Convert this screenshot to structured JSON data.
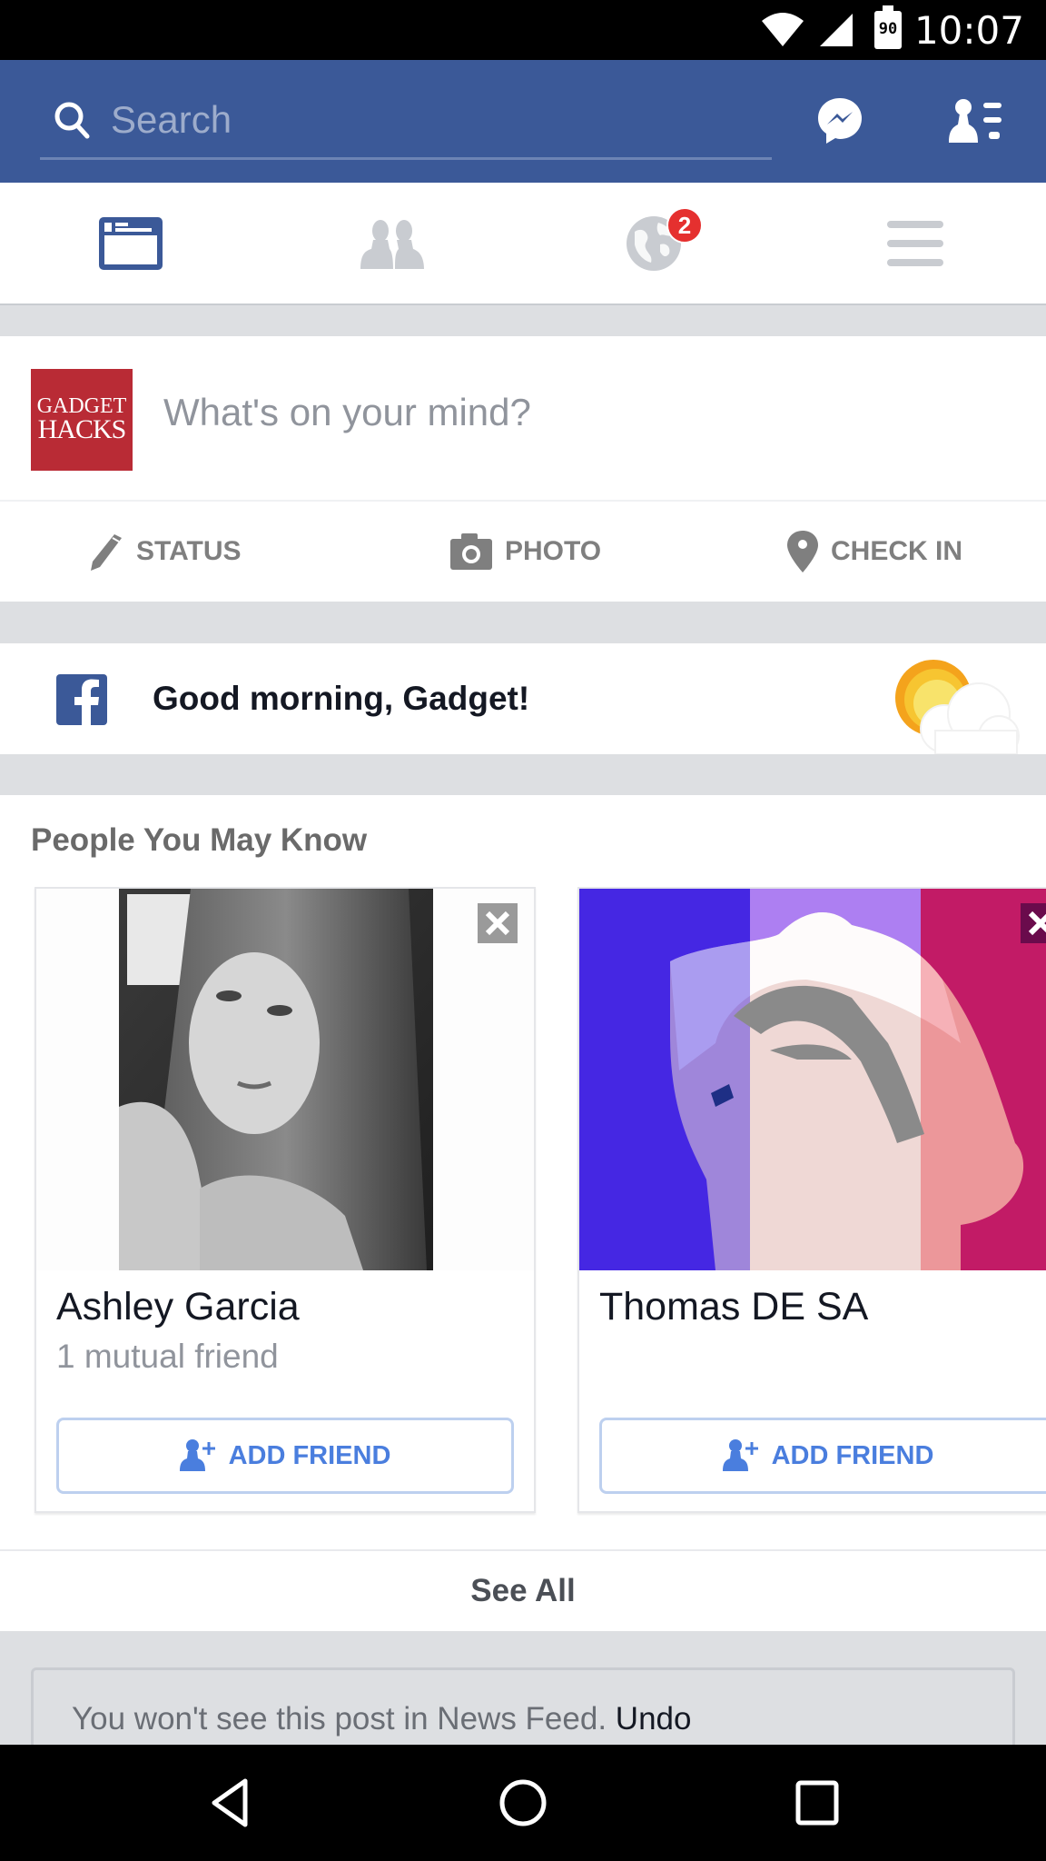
{
  "status_bar": {
    "time": "10:07",
    "battery_level": "90",
    "icons": [
      "wifi-icon",
      "cell-signal-icon",
      "battery-icon"
    ]
  },
  "header": {
    "search_placeholder": "Search",
    "search_value": "",
    "icons": [
      "search-icon",
      "messenger-icon",
      "friend-requests-icon"
    ]
  },
  "tabs": [
    {
      "name": "news-feed",
      "icon": "news-feed-icon",
      "active": true
    },
    {
      "name": "friends",
      "icon": "friends-icon",
      "active": false
    },
    {
      "name": "notifications",
      "icon": "globe-icon",
      "active": false,
      "badge": "2"
    },
    {
      "name": "more",
      "icon": "menu-icon",
      "active": false
    }
  ],
  "composer": {
    "avatar_line1": "GADGET",
    "avatar_line2": "HACKS",
    "placeholder": "What's on your mind?",
    "actions": [
      {
        "label": "STATUS",
        "icon": "pencil-icon"
      },
      {
        "label": "PHOTO",
        "icon": "camera-icon"
      },
      {
        "label": "CHECK IN",
        "icon": "location-pin-icon"
      }
    ]
  },
  "greeting": {
    "text": "Good morning, Gadget!",
    "icon": "partly-sunny-icon"
  },
  "pymk": {
    "title": "People You May Know",
    "people": [
      {
        "name": "Ashley Garcia",
        "mutual": "1 mutual friend",
        "button": "ADD FRIEND"
      },
      {
        "name": "Thomas DE SA",
        "mutual": "",
        "button": "ADD FRIEND"
      }
    ],
    "see_all": "See All"
  },
  "hidden_post": {
    "message": "You won't see this post in News Feed.",
    "undo": "Undo"
  },
  "nav_bar": {
    "icons": [
      "back-icon",
      "home-icon",
      "recents-icon"
    ]
  },
  "colors": {
    "brand_blue": "#3b5998",
    "badge_red": "#e5302f",
    "add_friend_blue": "#4a7ede",
    "feed_bg": "#dddfe2"
  }
}
